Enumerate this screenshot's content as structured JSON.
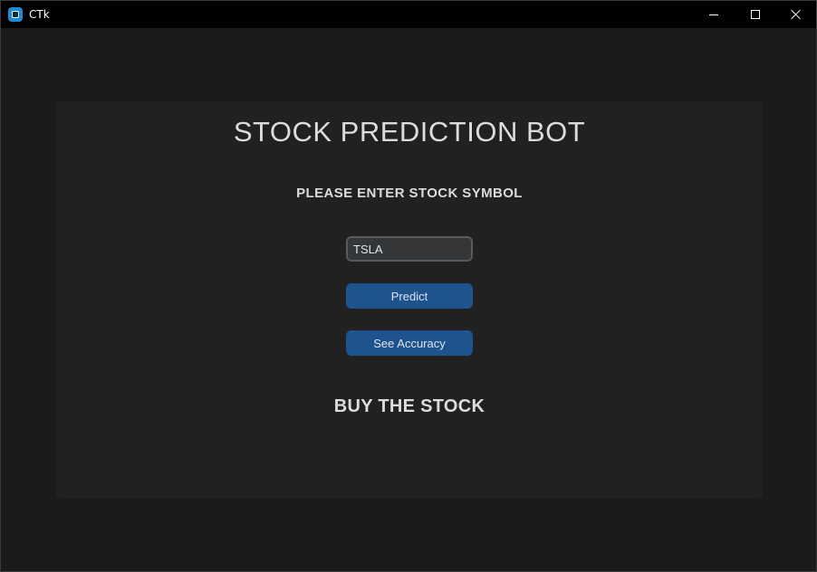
{
  "window": {
    "title": "CTk",
    "icon": "ctk-app-icon",
    "controls": [
      "minimize-icon",
      "maximize-icon",
      "close-icon"
    ]
  },
  "app": {
    "title": "STOCK PREDICTION BOT",
    "prompt": "PLEASE ENTER STOCK SYMBOL",
    "symbol_input": {
      "value": "TSLA",
      "placeholder": ""
    },
    "predict_label": "Predict",
    "accuracy_label": "See Accuracy",
    "result": "BUY THE STOCK"
  },
  "colors": {
    "window_bg": "#1b1b1b",
    "panel_bg": "#212121",
    "button": "#1f538d",
    "input_bg": "#343638",
    "input_border": "#565b5e",
    "text": "#dcdcdc"
  }
}
